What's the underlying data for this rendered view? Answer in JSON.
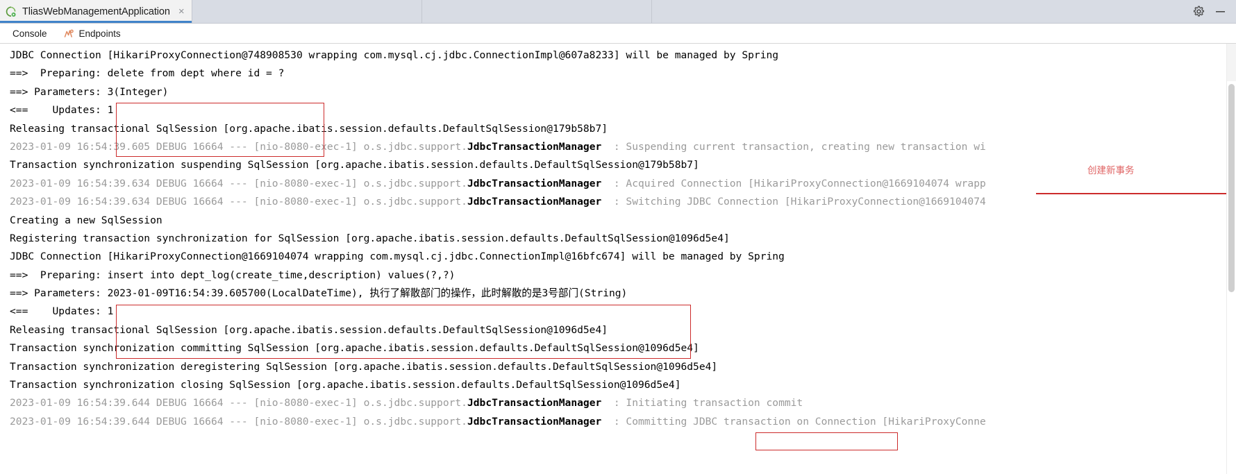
{
  "window": {
    "run_tab": {
      "icon": "spring-boot-run-icon",
      "label": "TliasWebManagementApplication",
      "close": "×"
    },
    "controls": {
      "settings_icon": "gear-icon",
      "minimize_icon": "minimize-icon"
    }
  },
  "subtabs": [
    {
      "id": "console",
      "label": "Console",
      "icon": "console-icon",
      "active": true
    },
    {
      "id": "endpoints",
      "label": "Endpoints",
      "icon": "endpoints-icon",
      "active": false
    }
  ],
  "annotations": {
    "create_new_transaction": "创建新事务"
  },
  "colors": {
    "annotation_red": "#cc2b2b",
    "annotation_text_red": "#e06666",
    "log_gray": "#9a9a9a",
    "tab_accent": "#4083c9",
    "tabstrip_bg": "#d8dce4"
  },
  "console": {
    "lines": [
      {
        "id": "l1",
        "segments": [
          {
            "text": "JDBC Connection [HikariProxyConnection@748908530 wrapping com.mysql.cj.jdbc.ConnectionImpl@607a8233] will be managed by Spring",
            "style": "black"
          }
        ]
      },
      {
        "id": "l2",
        "segments": [
          {
            "text": "==>  Preparing: delete from dept where id = ?",
            "style": "black"
          }
        ]
      },
      {
        "id": "l3",
        "segments": [
          {
            "text": "==> Parameters: 3(Integer)",
            "style": "black"
          }
        ]
      },
      {
        "id": "l4",
        "segments": [
          {
            "text": "<==    Updates: 1",
            "style": "black"
          }
        ]
      },
      {
        "id": "l5",
        "segments": [
          {
            "text": "Releasing transactional SqlSession [org.apache.ibatis.session.defaults.DefaultSqlSession@179b58b7]",
            "style": "black"
          }
        ]
      },
      {
        "id": "l6",
        "segments": [
          {
            "text": "2023-01-09 16:54:39.605 DEBUG 16664 --- [nio-8080-exec-1] o.s.jdbc.support.",
            "style": "gray"
          },
          {
            "text": "JdbcTransactionManager",
            "style": "bold"
          },
          {
            "text": "  : Suspending current transaction, creating new transaction wi",
            "style": "gray"
          }
        ]
      },
      {
        "id": "l7",
        "segments": [
          {
            "text": "Transaction synchronization suspending SqlSession [org.apache.ibatis.session.defaults.DefaultSqlSession@179b58b7]",
            "style": "black"
          }
        ]
      },
      {
        "id": "l8",
        "segments": [
          {
            "text": "2023-01-09 16:54:39.634 DEBUG 16664 --- [nio-8080-exec-1] o.s.jdbc.support.",
            "style": "gray"
          },
          {
            "text": "JdbcTransactionManager",
            "style": "bold"
          },
          {
            "text": "  : Acquired Connection [HikariProxyConnection@1669104074 wrapp",
            "style": "gray"
          }
        ]
      },
      {
        "id": "l9",
        "segments": [
          {
            "text": "2023-01-09 16:54:39.634 DEBUG 16664 --- [nio-8080-exec-1] o.s.jdbc.support.",
            "style": "gray"
          },
          {
            "text": "JdbcTransactionManager",
            "style": "bold"
          },
          {
            "text": "  : Switching JDBC Connection [HikariProxyConnection@1669104074",
            "style": "gray"
          }
        ]
      },
      {
        "id": "l10",
        "segments": [
          {
            "text": "Creating a new SqlSession",
            "style": "black"
          }
        ]
      },
      {
        "id": "l11",
        "segments": [
          {
            "text": "Registering transaction synchronization for SqlSession [org.apache.ibatis.session.defaults.DefaultSqlSession@1096d5e4]",
            "style": "black"
          }
        ]
      },
      {
        "id": "l12",
        "segments": [
          {
            "text": "JDBC Connection [HikariProxyConnection@1669104074 wrapping com.mysql.cj.jdbc.ConnectionImpl@16bfc674] will be managed by Spring",
            "style": "black"
          }
        ]
      },
      {
        "id": "l13",
        "segments": [
          {
            "text": "==>  Preparing: insert into dept_log(create_time,description) values(?,?)",
            "style": "black"
          }
        ]
      },
      {
        "id": "l14",
        "segments": [
          {
            "text": "==> Parameters: 2023-01-09T16:54:39.605700(LocalDateTime), 执行了解散部门的操作，此时解散的是3号部门(String)",
            "style": "black"
          }
        ]
      },
      {
        "id": "l15",
        "segments": [
          {
            "text": "<==    Updates: 1",
            "style": "black"
          }
        ]
      },
      {
        "id": "l16",
        "segments": [
          {
            "text": "Releasing transactional SqlSession [org.apache.ibatis.session.defaults.DefaultSqlSession@1096d5e4]",
            "style": "black"
          }
        ]
      },
      {
        "id": "l17",
        "segments": [
          {
            "text": "Transaction synchronization committing SqlSession [org.apache.ibatis.session.defaults.DefaultSqlSession@1096d5e4]",
            "style": "black"
          }
        ]
      },
      {
        "id": "l18",
        "segments": [
          {
            "text": "Transaction synchronization deregistering SqlSession [org.apache.ibatis.session.defaults.DefaultSqlSession@1096d5e4]",
            "style": "black"
          }
        ]
      },
      {
        "id": "l19",
        "segments": [
          {
            "text": "Transaction synchronization closing SqlSession [org.apache.ibatis.session.defaults.DefaultSqlSession@1096d5e4]",
            "style": "black"
          }
        ]
      },
      {
        "id": "l20",
        "segments": [
          {
            "text": "2023-01-09 16:54:39.644 DEBUG 16664 --- [nio-8080-exec-1] o.s.jdbc.support.",
            "style": "gray"
          },
          {
            "text": "JdbcTransactionManager",
            "style": "bold"
          },
          {
            "text": "  : Initiating transaction commit",
            "style": "gray"
          }
        ]
      },
      {
        "id": "l21",
        "segments": [
          {
            "text": "2023-01-09 16:54:39.644 DEBUG 16664 --- [nio-8080-exec-1] o.s.jdbc.support.",
            "style": "gray"
          },
          {
            "text": "JdbcTransactionManager",
            "style": "bold"
          },
          {
            "text": "  : Committing JDBC transaction on Connection [HikariProxyConne",
            "style": "gray"
          }
        ]
      }
    ]
  }
}
